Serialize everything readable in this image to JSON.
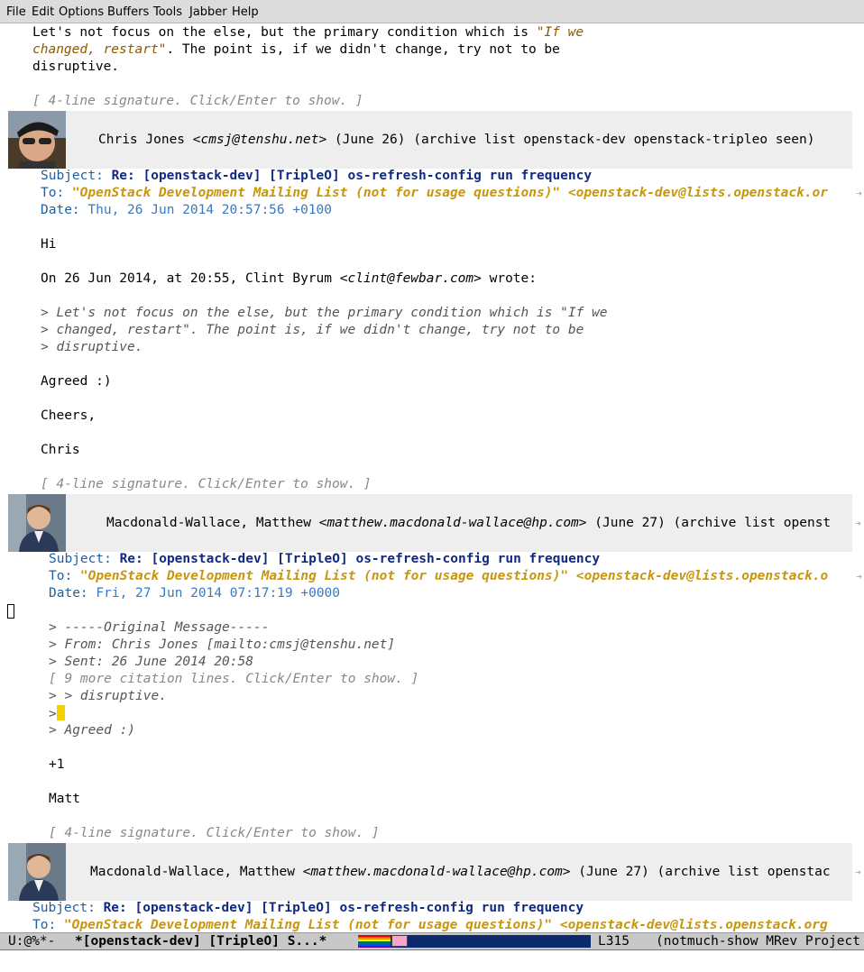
{
  "menu": [
    "File",
    "Edit",
    "Options",
    "Buffers",
    "Tools",
    "Jabber",
    "Help"
  ],
  "top_quote": {
    "l1a": "Let's not focus on the else, but the primary condition which is ",
    "l1b": "\"If we",
    "l2a": "changed, restart\"",
    "l2b": ". The point is, if we didn't change, try not to be",
    "l3": "disruptive.",
    "sig": "[ 4-line signature. Click/Enter to show. ]"
  },
  "msg1": {
    "name": "Chris Jones <",
    "email": "cmsj@tenshu.net",
    "rest": "> (June 26) (archive list openstack-dev openstack-tripleo seen)",
    "subject_key": "Subject: ",
    "subject": "Re: [openstack-dev] [TripleO] os-refresh-config run frequency",
    "to_key": "To: ",
    "to": "\"OpenStack Development Mailing List (not for usage questions)\" <openstack-dev@lists.openstack.or",
    "date_key": "Date: ",
    "date": "Thu, 26 Jun 2014 20:57:56 +0100",
    "hi": "Hi",
    "wrote_a": "On 26 Jun 2014, at 20:55, Clint Byrum <",
    "wrote_email": "clint@fewbar.com",
    "wrote_b": "> wrote:",
    "cite1": "> Let's not focus on the else, but the primary condition which is \"If we",
    "cite2": "> changed, restart\". The point is, if we didn't change, try not to be",
    "cite3": "> disruptive.",
    "agreed": "Agreed :)",
    "cheers": "Cheers,",
    "sign": "Chris",
    "sig": "[ 4-line signature. Click/Enter to show. ]"
  },
  "msg2": {
    "name": "Macdonald-Wallace, Matthew <",
    "email": "matthew.macdonald-wallace@hp.com",
    "rest": "> (June 27) (archive list openst",
    "subject_key": "Subject: ",
    "subject": "Re: [openstack-dev] [TripleO] os-refresh-config run frequency",
    "to_key": "To: ",
    "to": "\"OpenStack Development Mailing List (not for usage questions)\" <openstack-dev@lists.openstack.o",
    "date_key": "Date: ",
    "date": "Fri, 27 Jun 2014 07:17:19 +0000",
    "cite1": "> -----Original Message-----",
    "cite2": "> From: Chris Jones [mailto:cmsj@tenshu.net]",
    "cite3": "> Sent: 26 June 2014 20:58",
    "more": "[ 9 more citation lines. Click/Enter to show. ]",
    "cite4": "> > disruptive.",
    "cite5": ">",
    "cite6": "> Agreed :)",
    "plus": "+1",
    "sign": "Matt",
    "sig": "[ 4-line signature. Click/Enter to show. ]"
  },
  "msg3": {
    "name": "Macdonald-Wallace, Matthew <",
    "email": "matthew.macdonald-wallace@hp.com",
    "rest": "> (June 27) (archive list openstac",
    "subject_key": "Subject: ",
    "subject": "Re: [openstack-dev] [TripleO] os-refresh-config run frequency",
    "to_key": "To: ",
    "to": "\"OpenStack Development Mailing List (not for usage questions)\" <openstack-dev@lists.openstack.org"
  },
  "modeline": {
    "state": "U:@%*-",
    "buffer": "*[openstack-dev] [TripleO] S...*",
    "line": "L315",
    "modes": "(notmuch-show MRev Project"
  },
  "colors": {
    "subject": "#102a80",
    "to": "#c8960c",
    "date": "#3a78c0",
    "cursor": "#f5d000"
  }
}
